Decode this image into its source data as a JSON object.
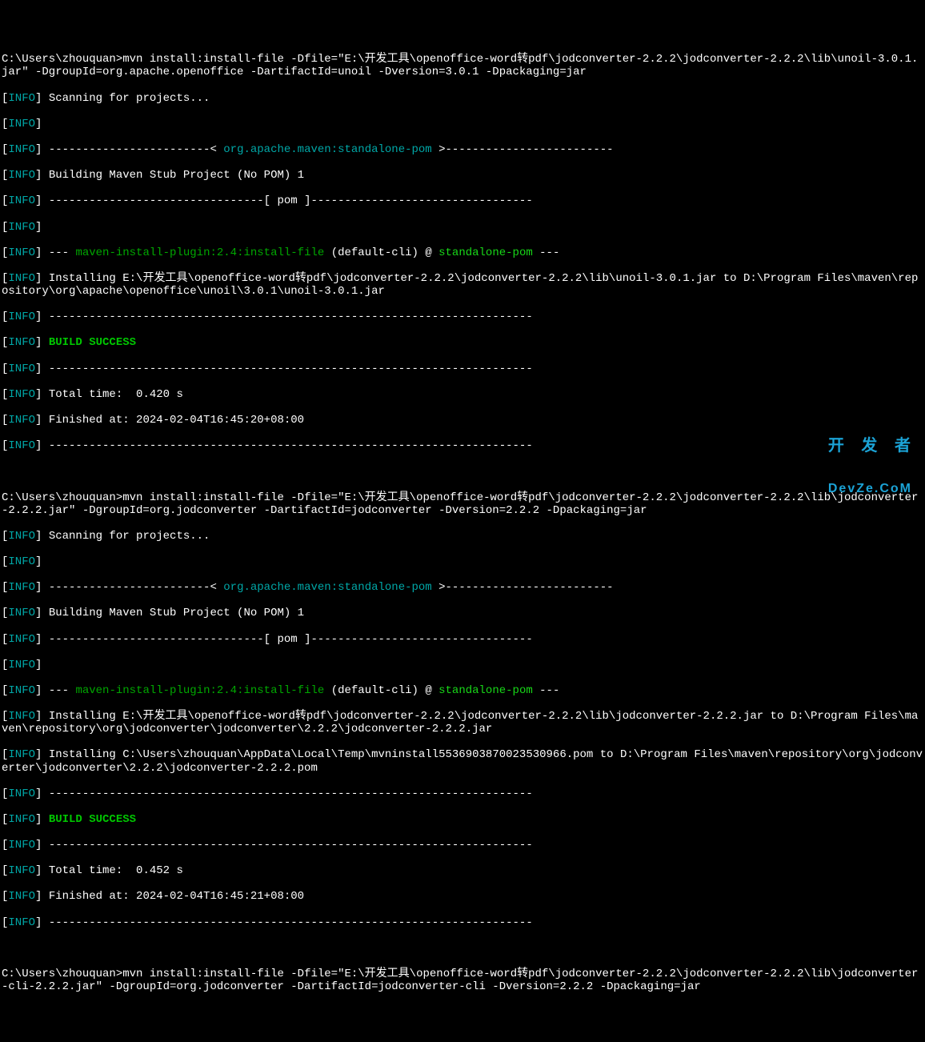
{
  "prompt1": "C:\\Users\\zhouquan>",
  "cmd1": "mvn install:install-file -Dfile=\"E:\\开发工具\\openoffice-word转pdf\\jodconverter-2.2.2\\jodconverter-2.2.2\\lib\\unoil-3.0.1.jar\" -DgroupId=org.apache.openoffice -DartifactId=unoil -Dversion=3.0.1 -Dpackaging=jar",
  "info_label": "INFO",
  "scanning": " Scanning for projects...",
  "empty": "",
  "dashes_open": " ------------------------< ",
  "pom_coord": "org.apache.maven:standalone-pom",
  "dashes_close": " >-------------------------",
  "building": " Building Maven Stub Project (No POM) 1",
  "pom_packaging": " --------------------------------[ pom ]---------------------------------",
  "plugin_prefix": " --- ",
  "plugin_name": "maven-install-plugin:2.4:install-file",
  "plugin_suffix": " (default-cli) @ ",
  "plugin_project": "standalone-pom",
  "plugin_end": " ---",
  "installing1": " Installing E:\\开发工具\\openoffice-word转pdf\\jodconverter-2.2.2\\jodconverter-2.2.2\\lib\\unoil-3.0.1.jar to D:\\Program Files\\maven\\repository\\org\\apache\\openoffice\\unoil\\3.0.1\\unoil-3.0.1.jar",
  "divider": " ------------------------------------------------------------------------",
  "build_success": " BUILD SUCCESS",
  "total_time1": " Total time:  0.420 s",
  "finished1": " Finished at: 2024-02-04T16:45:20+08:00",
  "prompt2": "C:\\Users\\zhouquan>",
  "cmd2": "mvn install:install-file -Dfile=\"E:\\开发工具\\openoffice-word转pdf\\jodconverter-2.2.2\\jodconverter-2.2.2\\lib\\jodconverter-2.2.2.jar\" -DgroupId=org.jodconverter -DartifactId=jodconverter -Dversion=2.2.2 -Dpackaging=jar",
  "installing2": " Installing E:\\开发工具\\openoffice-word转pdf\\jodconverter-2.2.2\\jodconverter-2.2.2\\lib\\jodconverter-2.2.2.jar to D:\\Program Files\\maven\\repository\\org\\jodconverter\\jodconverter\\2.2.2\\jodconverter-2.2.2.jar",
  "installing3": " Installing C:\\Users\\zhouquan\\AppData\\Local\\Temp\\mvninstall5536903870023530966.pom to D:\\Program Files\\maven\\repository\\org\\jodconverter\\jodconverter\\2.2.2\\jodconverter-2.2.2.pom",
  "total_time2": " Total time:  0.452 s",
  "finished2": " Finished at: 2024-02-04T16:45:21+08:00",
  "prompt3": "C:\\Users\\zhouquan>",
  "cmd3": "mvn install:install-file -Dfile=\"E:\\开发工具\\openoffice-word转pdf\\jodconverter-2.2.2\\jodconverter-2.2.2\\lib\\jodconverter-cli-2.2.2.jar\" -DgroupId=org.jodconverter -DartifactId=jodconverter-cli -Dversion=2.2.2 -Dpackaging=jar",
  "watermark_top": "开 发 者",
  "watermark_bottom": "DevZe.CoM"
}
